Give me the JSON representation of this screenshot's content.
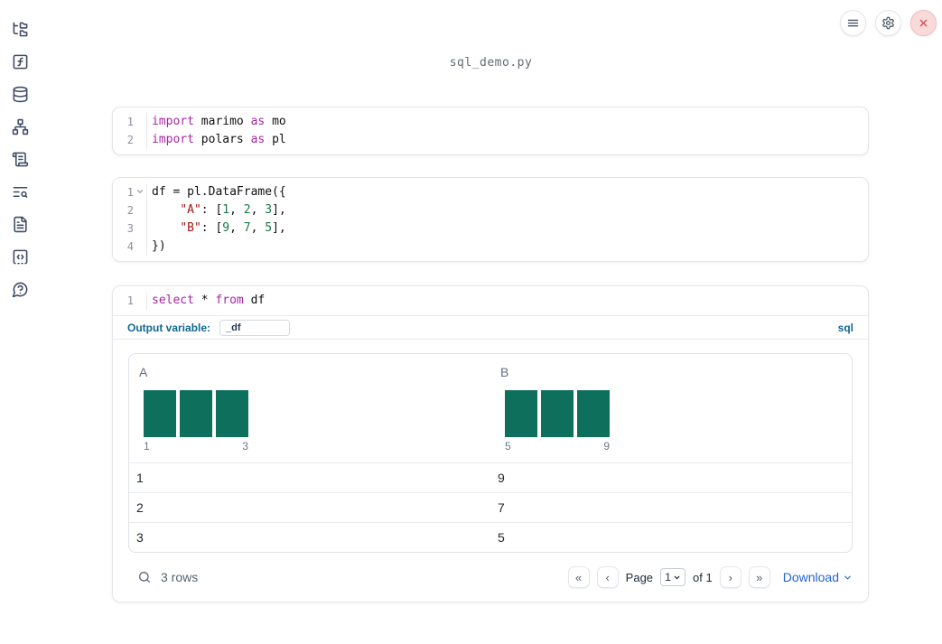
{
  "window": {
    "title": "sql_demo.py"
  },
  "colors": {
    "accent_blue": "#10688f",
    "link_blue": "#2264d1",
    "bar_green": "#0e6f5c",
    "keyword": "#a626a4",
    "string": "#a31515",
    "number": "#187a44",
    "close_red": "#d0504e"
  },
  "sidebar": {
    "items": [
      {
        "icon": "file-tree"
      },
      {
        "icon": "function-square"
      },
      {
        "icon": "database"
      },
      {
        "icon": "dependency-graph"
      },
      {
        "icon": "scroll-text"
      },
      {
        "icon": "text-search"
      },
      {
        "icon": "file-text"
      },
      {
        "icon": "code-snippets"
      },
      {
        "icon": "help-bubble"
      }
    ]
  },
  "topbar": {
    "buttons": [
      {
        "icon": "menu"
      },
      {
        "icon": "settings"
      },
      {
        "icon": "close"
      }
    ]
  },
  "cells": [
    {
      "lines": [
        {
          "num": "1",
          "tokens": [
            {
              "c": "kw",
              "t": "import"
            },
            {
              "c": "pl",
              "t": " marimo "
            },
            {
              "c": "kw",
              "t": "as"
            },
            {
              "c": "pl",
              "t": " mo"
            }
          ]
        },
        {
          "num": "2",
          "tokens": [
            {
              "c": "kw",
              "t": "import"
            },
            {
              "c": "pl",
              "t": " polars "
            },
            {
              "c": "kw",
              "t": "as"
            },
            {
              "c": "pl",
              "t": " pl"
            }
          ]
        }
      ]
    },
    {
      "lines": [
        {
          "num": "1",
          "tokens": [
            {
              "c": "pl",
              "t": "df = pl.DataFrame({"
            }
          ]
        },
        {
          "num": "2",
          "tokens": [
            {
              "c": "pl",
              "t": "    "
            },
            {
              "c": "str",
              "t": "\"A\""
            },
            {
              "c": "pl",
              "t": ": ["
            },
            {
              "c": "num",
              "t": "1"
            },
            {
              "c": "pl",
              "t": ", "
            },
            {
              "c": "num",
              "t": "2"
            },
            {
              "c": "pl",
              "t": ", "
            },
            {
              "c": "num",
              "t": "3"
            },
            {
              "c": "pl",
              "t": "],"
            }
          ]
        },
        {
          "num": "3",
          "tokens": [
            {
              "c": "pl",
              "t": "    "
            },
            {
              "c": "str",
              "t": "\"B\""
            },
            {
              "c": "pl",
              "t": ": ["
            },
            {
              "c": "num",
              "t": "9"
            },
            {
              "c": "pl",
              "t": ", "
            },
            {
              "c": "num",
              "t": "7"
            },
            {
              "c": "pl",
              "t": ", "
            },
            {
              "c": "num",
              "t": "5"
            },
            {
              "c": "pl",
              "t": "],"
            }
          ]
        },
        {
          "num": "4",
          "tokens": [
            {
              "c": "pl",
              "t": "})"
            }
          ]
        }
      ]
    },
    {
      "lines": [
        {
          "num": "1",
          "tokens": [
            {
              "c": "kw",
              "t": "select"
            },
            {
              "c": "pl",
              "t": " * "
            },
            {
              "c": "kw",
              "t": "from"
            },
            {
              "c": "pl",
              "t": " df"
            }
          ]
        }
      ]
    }
  ],
  "sql_toolbar": {
    "label": "Output variable:",
    "value": "_df",
    "language": "sql"
  },
  "table": {
    "columns": [
      {
        "header": "A",
        "hist": {
          "values": [
            1,
            1,
            1
          ],
          "min": "1",
          "max": "3"
        }
      },
      {
        "header": "B",
        "hist": {
          "values": [
            1,
            1,
            1
          ],
          "min": "5",
          "max": "9"
        }
      }
    ],
    "rows": [
      {
        "a": "1",
        "b": "9"
      },
      {
        "a": "2",
        "b": "7"
      },
      {
        "a": "3",
        "b": "5"
      }
    ],
    "row_count": "3 rows",
    "pagination": {
      "first": "«",
      "prev": "‹",
      "page_label": "Page",
      "page": "1",
      "of_label": "of 1",
      "next": "›",
      "last": "»"
    },
    "download_label": "Download"
  }
}
